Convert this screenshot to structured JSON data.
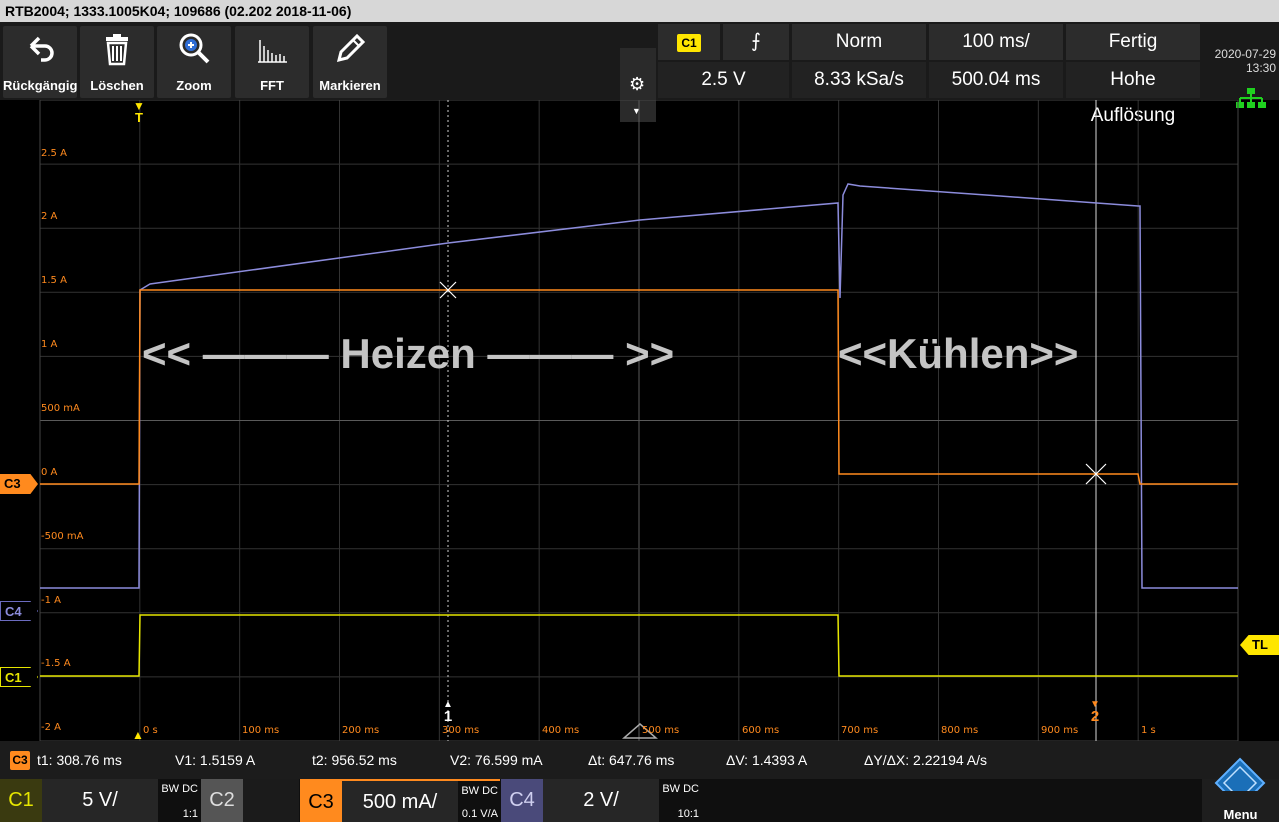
{
  "titlebar": {
    "text": "RTB2004; 1333.1005K04; 109686 (02.202 2018-11-06)"
  },
  "toolbar": {
    "buttons": [
      {
        "label": "Rückgängig",
        "icon": "undo-icon"
      },
      {
        "label": "Löschen",
        "icon": "trash-icon"
      },
      {
        "label": "Zoom",
        "icon": "zoom-icon"
      },
      {
        "label": "FFT",
        "icon": "fft-icon"
      },
      {
        "label": "Markieren",
        "icon": "pencil-icon"
      }
    ],
    "settings_icon": "gear-icon",
    "trigger": {
      "source": "C1",
      "slope_symbol": "⨍",
      "mode": "Norm",
      "timebase": "100 ms/",
      "status": "Fertig",
      "level": "2.5 V",
      "sample_rate": "8.33 kSa/s",
      "record_length": "500.04 ms",
      "acq_mode": "Hohe Auflösung"
    },
    "date": "2020-07-29",
    "time": "13:30"
  },
  "screen": {
    "y_labels": [
      "2.5 A",
      "2 A",
      "1.5 A",
      "1 A",
      "500 mA",
      "0 A",
      "-500 mA",
      "-1 A",
      "-1.5 A",
      "-2 A"
    ],
    "t_labels": [
      "0 s",
      "100 ms",
      "200 ms",
      "300 ms",
      "400 ms",
      "500 ms",
      "600 ms",
      "700 ms",
      "800 ms",
      "900 ms",
      "1 s"
    ],
    "markers": {
      "c3": "C3",
      "c4": "C4",
      "c1": "C1",
      "tl": "TL",
      "trigger": "T",
      "cursor1": "1",
      "cursor2": "2"
    },
    "overlay_heat": "<< ——— Heizen ——— >>",
    "overlay_cool": "<<Kühlen>>"
  },
  "cursor": {
    "channel": "C3",
    "t1": "t1: 308.76 ms",
    "v1": "V1: 1.5159 A",
    "t2": "t2: 956.52 ms",
    "v2": "V2: 76.599 mA",
    "dt": "Δt: 647.76 ms",
    "dv": "ΔV: 1.4393 A",
    "slope": "ΔY/ΔX: 2.22194 A/s"
  },
  "channels": [
    {
      "name": "C1",
      "scale": "5 V/",
      "coupling": "BW DC",
      "probe": "1:1",
      "color": "#e6e600"
    },
    {
      "name": "C2",
      "scale": "",
      "coupling": "",
      "probe": "",
      "color": "#8a8a8a"
    },
    {
      "name": "C3",
      "scale": "500 mA/",
      "coupling": "BW DC",
      "probe": "0.1 V/A",
      "color": "#ff8a1e"
    },
    {
      "name": "C4",
      "scale": "2 V/",
      "coupling": "BW DC",
      "probe": "10:1",
      "color": "#6b6bbf"
    }
  ],
  "menu": {
    "label": "Menu",
    "icon": "rs-logo-icon"
  },
  "colors": {
    "c1": "#e6e600",
    "c3": "#ff8a1e",
    "c4": "#8c8cdc",
    "accent": "#ffe600"
  }
}
